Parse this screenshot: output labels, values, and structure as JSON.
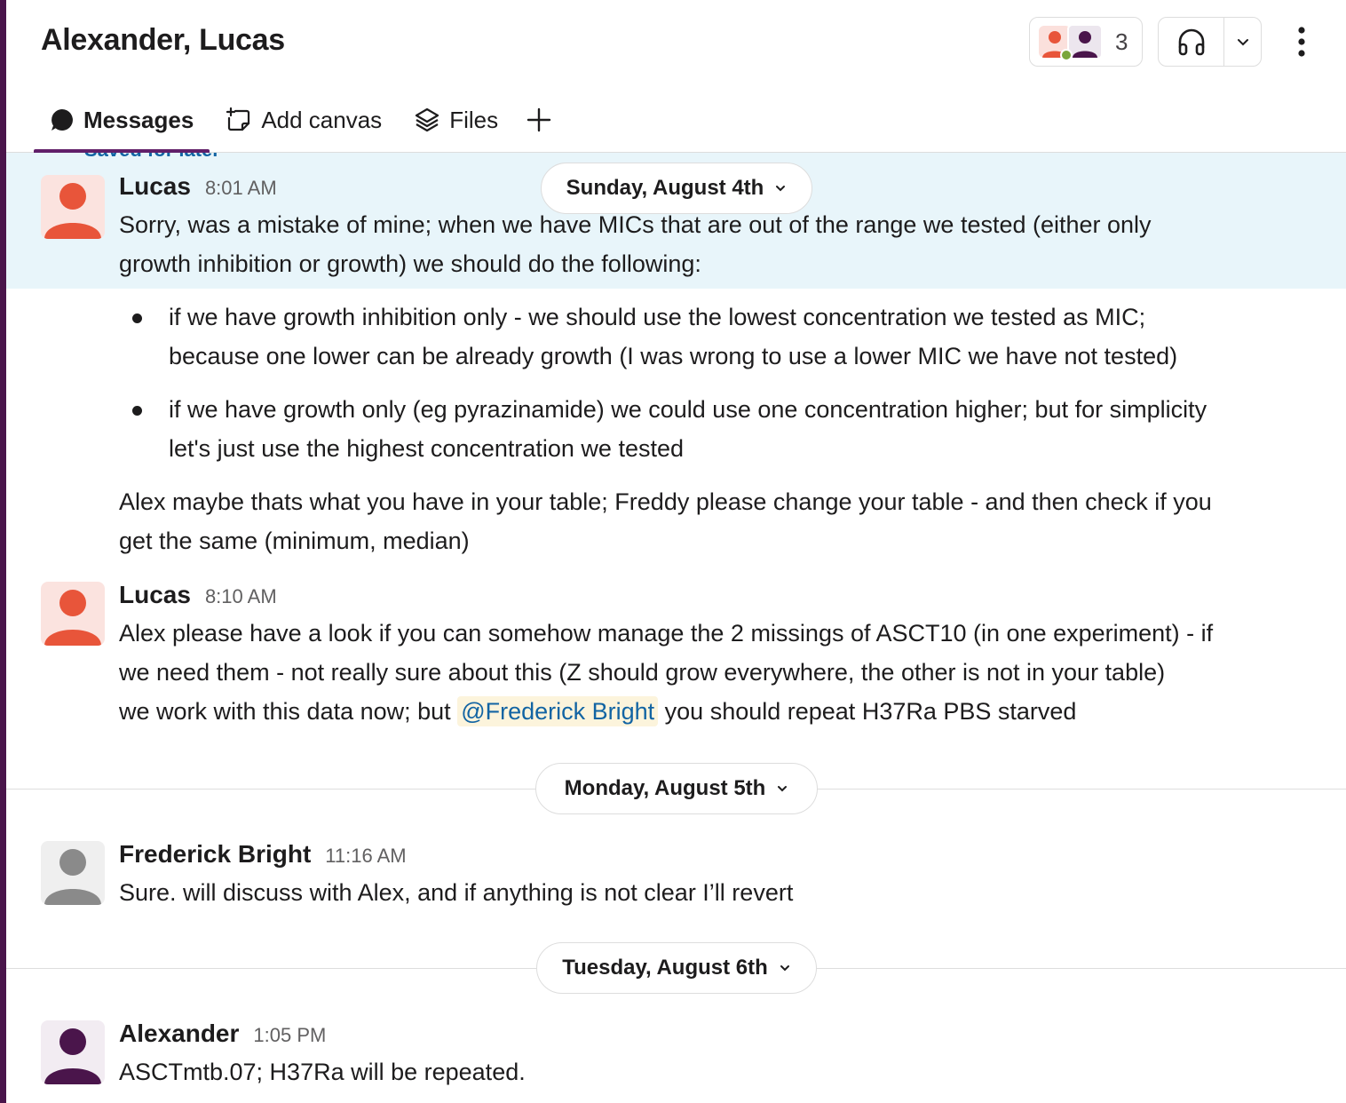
{
  "header": {
    "title": "Alexander, Lucas",
    "member_count": "3"
  },
  "tabs": [
    {
      "label": "Messages",
      "icon": "message-bubble-icon",
      "active": true
    },
    {
      "label": "Add canvas",
      "icon": "canvas-icon"
    },
    {
      "label": "Files",
      "icon": "files-layers-icon"
    },
    {
      "label": "",
      "icon": "plus-icon"
    }
  ],
  "saved_peek": "Saved for later",
  "dates": {
    "d1": "Sunday, August 4th",
    "d2": "Monday, August 5th",
    "d3": "Tuesday, August 6th"
  },
  "messages": [
    {
      "sender": "Lucas",
      "time": "8:01 AM",
      "line1": "Sorry, was a mistake of mine; when we have MICs that are out of the range we tested (either only",
      "line2": "growth inhibition or growth) we should do the following:",
      "bullets": [
        {
          "l1": "if we have growth inhibition only - we should use the lowest concentration we tested as MIC;",
          "l2": "because one lower can be already growth (I was wrong to use a lower MIC we have not tested)"
        },
        {
          "l1": "if we have growth only (eg pyrazinamide) we could use one concentration higher; but for simplicity",
          "l2": "let's just use the highest concentration we tested"
        }
      ],
      "tail1": "Alex maybe thats what you have in your table; Freddy please change your table - and then check if you",
      "tail2": "get the same (minimum, median)"
    },
    {
      "sender": "Lucas",
      "time": "8:10 AM",
      "line1": "Alex please have a look if you can somehow manage the 2 missings of ASCT10 (in one experiment) - if",
      "line2": "we need them - not really sure about this (Z should grow everywhere, the other is not in your table)",
      "line3_pre": "we work with this data now; but ",
      "mention": "@Frederick Bright",
      "line3_post": " you should repeat H37Ra PBS starved"
    },
    {
      "sender": "Frederick Bright",
      "time": "11:16 AM",
      "text": "Sure. will discuss with Alex, and if anything is not clear I’ll revert"
    },
    {
      "sender": "Alexander",
      "time": "1:05 PM",
      "text": "ASCTmtb.07; H37Ra will be repeated."
    }
  ],
  "colors": {
    "workspace_stripe": "#4a154b",
    "highlight_bg": "#e8f5fa",
    "avatar_orange": "#e8553a",
    "avatar_gray": "#8a8a8a",
    "avatar_purple": "#4a154b",
    "mention_bg": "#fcf4dc",
    "mention_text": "#1264a3"
  }
}
